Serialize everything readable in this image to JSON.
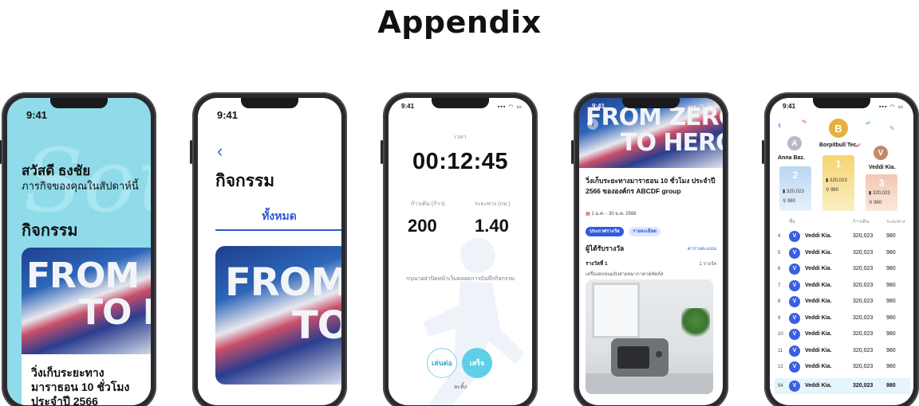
{
  "page": {
    "title": "Appendix"
  },
  "phone1": {
    "time": "9:41",
    "greeting": "สวัสดี ธงชัย",
    "subtitle": "ภารกิจของคุณในสัปดาห์นี้",
    "section_title": "กิจกรรม",
    "banner_line1": "FROM ZERO",
    "banner_line2": "TO HERO",
    "card_title": "วิ่งเก็บระยะทางมาราธอน 10 ชั่วโมง ประจำปี 2566"
  },
  "phone2": {
    "time": "9:41",
    "title": "กิจกรรม",
    "tab_all": "ทั้งหมด",
    "banner_line1": "FROM ZERO",
    "banner_line2": "TO HERO"
  },
  "phone3": {
    "time": "9:41",
    "time_label": "เวลา",
    "timer": "00:12:45",
    "steps_label": "ก้าวเดิน (ก้าว)",
    "distance_label": "ระยะทาง (กม.)",
    "steps_value": "200",
    "distance_value": "1.40",
    "note": "กรุณาอย่าปิดหน้าเว็บตลอดการบันทึกกิจกรรม",
    "resume_label": "เล่นต่อ",
    "finish_label": "เสร็จ",
    "cancel_label": "ละทิ้ง"
  },
  "phone4": {
    "time": "9:41",
    "banner_line1": "FROM ZERO",
    "banner_line2": "TO HERO",
    "event_title": "วิ่งเก็บระยะทางมาราธอน 10 ชั่วโมง ประจำปี 2566 ขององค์กร ABCDF group",
    "event_date": "1 ม.ค. - 30 ม.ค. 2566",
    "chip_prize": "ประกาศรางวัล",
    "chip_detail": "รายละเอียด",
    "winners_title": "ผู้ได้รับรางวัล",
    "rank_table_link": "ตารางคะแนน",
    "prize_title": "รางวัลที่ 1",
    "prize_count": "1 รางวัล",
    "prize_desc": "เครื่องอบขนมปังสายหมากาคาคหัตถ์ส"
  },
  "phone5": {
    "time": "9:41",
    "podium": [
      {
        "rank": "2",
        "name": "Anna Baz.",
        "badge": "A",
        "score": "320,023",
        "distance": "980",
        "color": "#b8b8c8"
      },
      {
        "rank": "1",
        "name": "Borpitbull Tec.",
        "badge": "B",
        "score": "320,023",
        "distance": "980",
        "color": "#e3b23c"
      },
      {
        "rank": "3",
        "name": "Veddi Kia.",
        "badge": "V",
        "score": "320,023",
        "distance": "980",
        "color": "#c18a6b"
      }
    ],
    "header_name": "ชื่อ",
    "header_steps": "ก้าวเดิน",
    "header_distance": "ระยะทาง",
    "rows": [
      {
        "rank": "4",
        "avatar": "V",
        "name": "Veddi Kia.",
        "score": "320,023",
        "distance": "980"
      },
      {
        "rank": "5",
        "avatar": "V",
        "name": "Veddi Kia.",
        "score": "320,023",
        "distance": "980"
      },
      {
        "rank": "6",
        "avatar": "V",
        "name": "Veddi Kia.",
        "score": "320,023",
        "distance": "980"
      },
      {
        "rank": "7",
        "avatar": "V",
        "name": "Veddi Kia.",
        "score": "320,023",
        "distance": "980"
      },
      {
        "rank": "8",
        "avatar": "V",
        "name": "Veddi Kia.",
        "score": "320,023",
        "distance": "980"
      },
      {
        "rank": "9",
        "avatar": "V",
        "name": "Veddi Kia.",
        "score": "320,023",
        "distance": "980"
      },
      {
        "rank": "10",
        "avatar": "V",
        "name": "Veddi Kia.",
        "score": "320,023",
        "distance": "980"
      },
      {
        "rank": "11",
        "avatar": "V",
        "name": "Veddi Kia.",
        "score": "320,023",
        "distance": "980"
      },
      {
        "rank": "12",
        "avatar": "V",
        "name": "Veddi Kia.",
        "score": "320,023",
        "distance": "980"
      },
      {
        "rank": "94",
        "avatar": "V",
        "name": "Veddi Kia.",
        "score": "320,023",
        "distance": "980",
        "me": true
      }
    ]
  }
}
